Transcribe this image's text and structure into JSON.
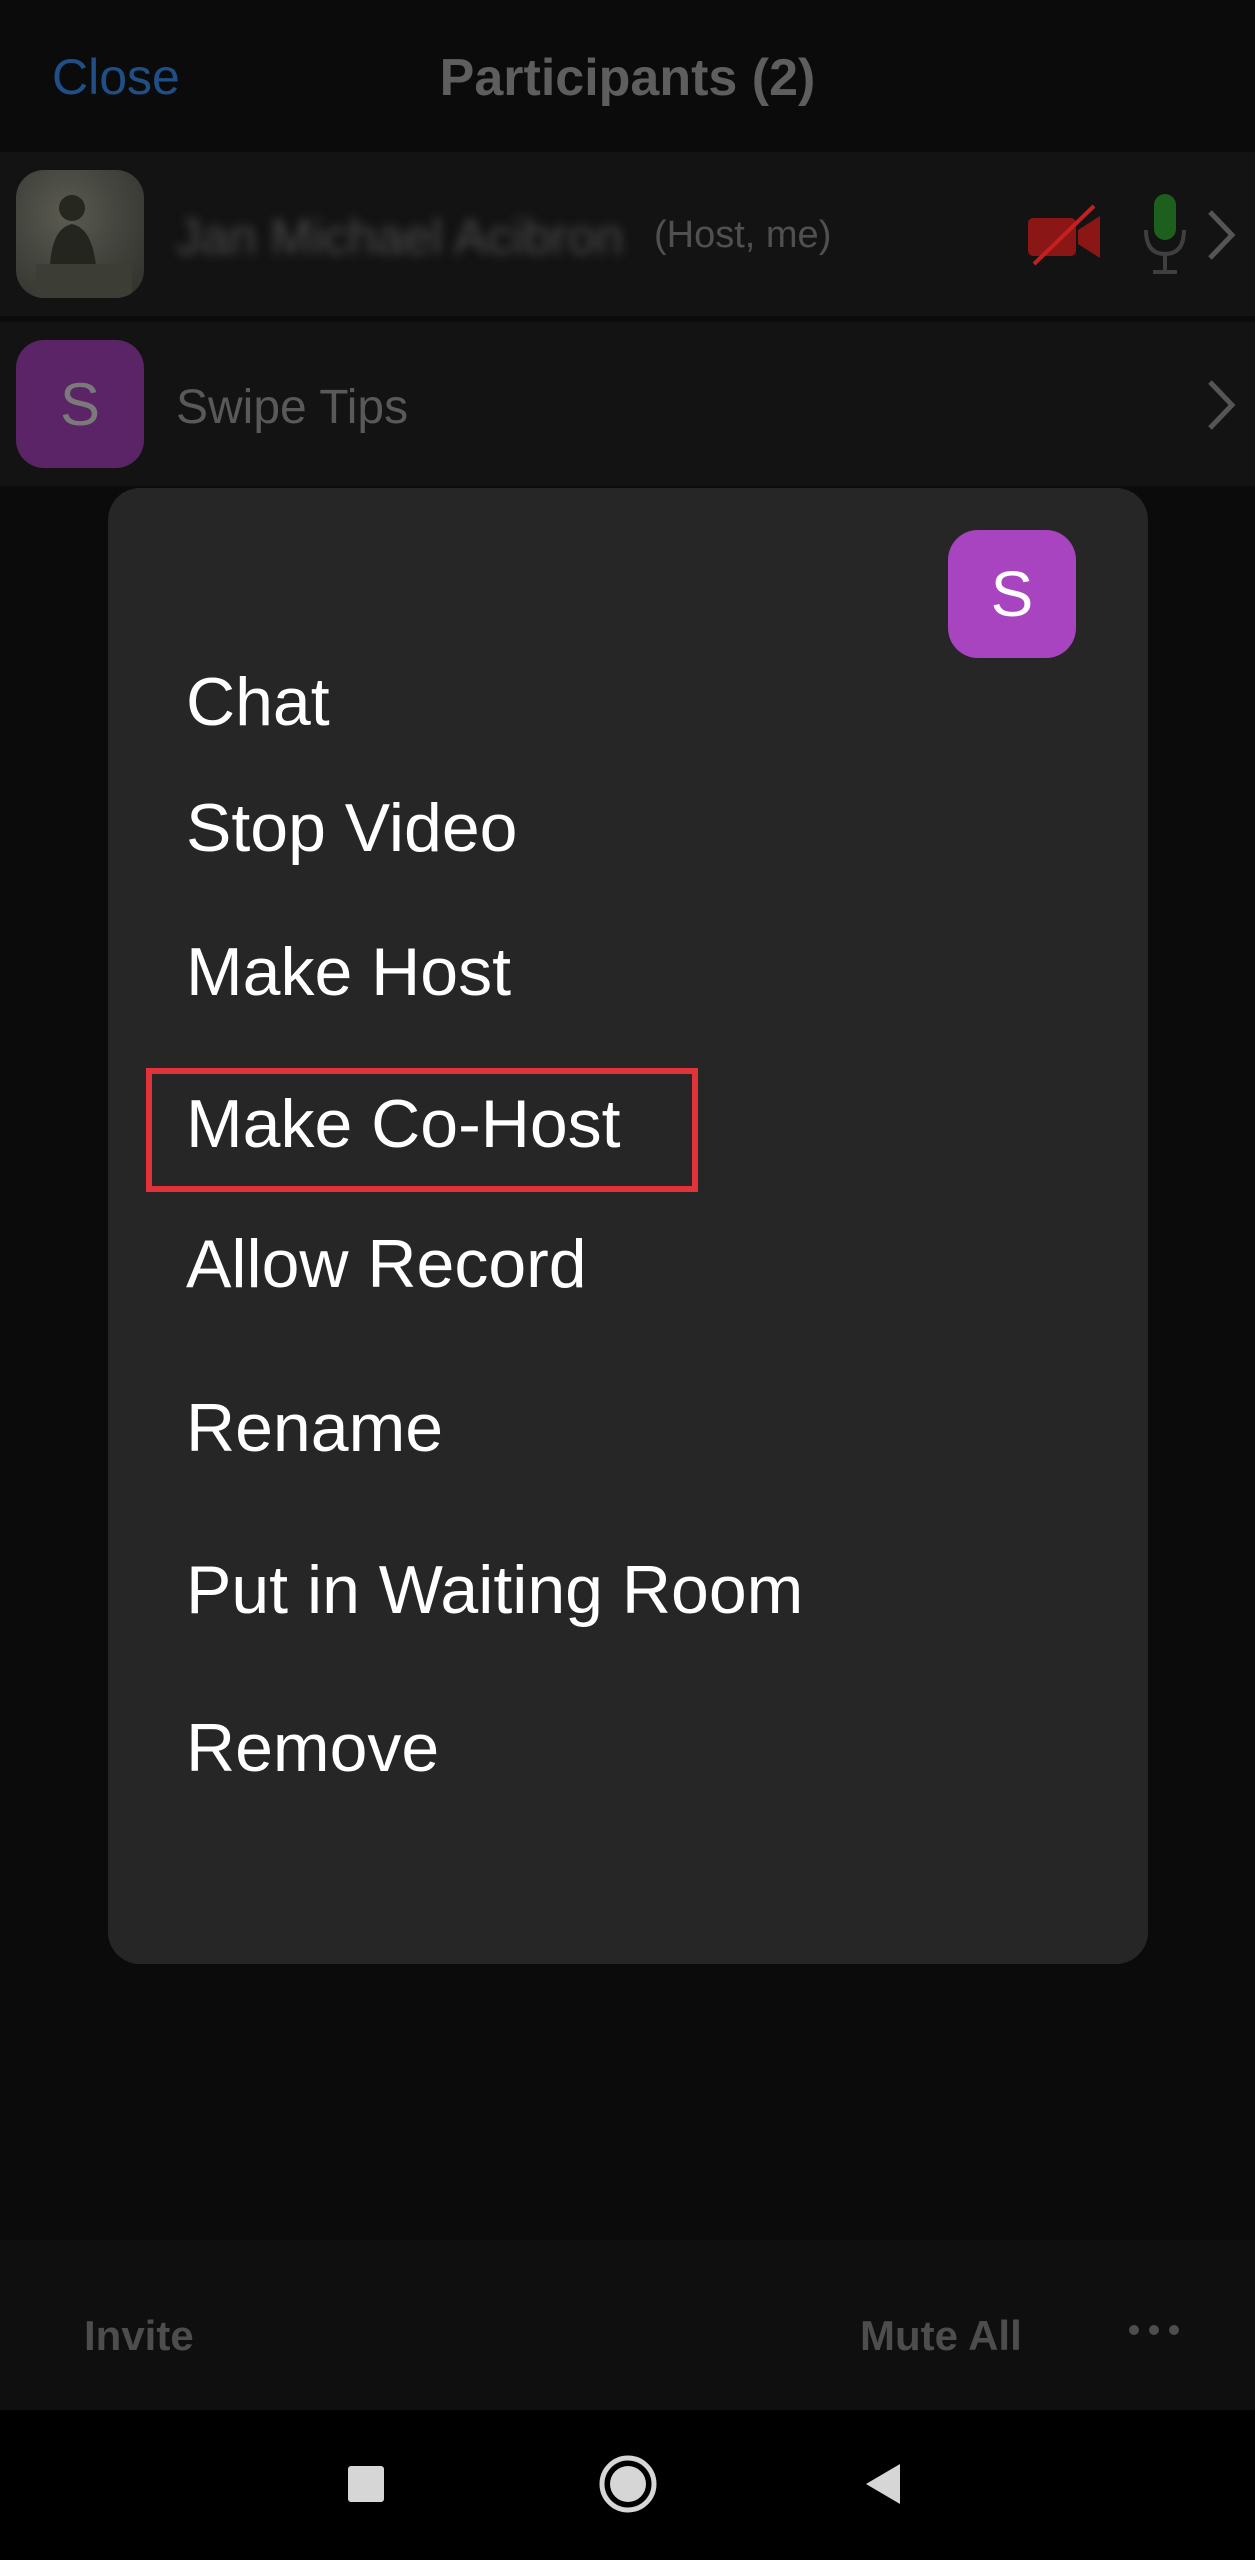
{
  "header": {
    "close_label": "Close",
    "title": "Participants (2)"
  },
  "participants": [
    {
      "name": "Jan Michael Acibron",
      "tag": "(Host, me)",
      "avatar": "photo-avatar",
      "video_icon": "video-off-icon",
      "audio_icon": "microphone-icon"
    },
    {
      "name": "Swipe Tips",
      "avatar_letter": "S"
    }
  ],
  "modal": {
    "avatar_letter": "S",
    "items": [
      "Chat",
      "Stop Video",
      "Make Host",
      "Make Co-Host",
      "Allow Record",
      "Rename",
      "Put in Waiting Room",
      "Remove"
    ],
    "highlighted_item": "Make Co-Host",
    "highlight_color": "#e2333b"
  },
  "toolbar": {
    "invite_label": "Invite",
    "mute_all_label": "Mute All",
    "more_icon": "more-horizontal-icon"
  },
  "colors": {
    "accent_link": "#1f4f86",
    "modal_avatar": "#a944c0",
    "video_off": "#b51e1e",
    "mic_active": "#1f7a1f"
  }
}
